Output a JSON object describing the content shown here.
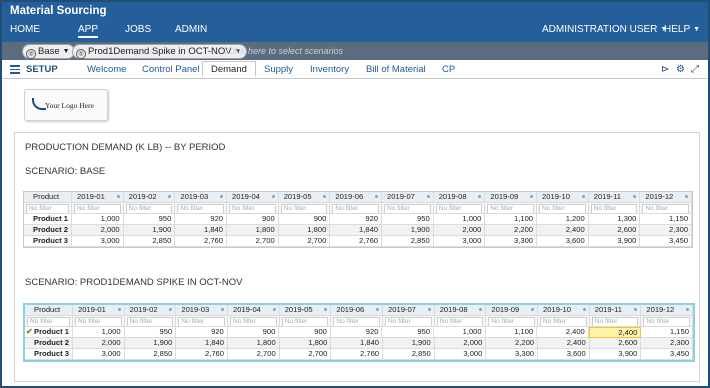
{
  "app": {
    "title": "Material Sourcing"
  },
  "nav": {
    "home": "HOME",
    "app": "APP",
    "jobs": "JOBS",
    "admin": "ADMIN",
    "user": "ADMINISTRATION USER",
    "help": "HELP"
  },
  "scenario_bar": {
    "base": "Base",
    "compare": "Prod1Demand Spike in OCT-NOV",
    "hint": "Click here to select scenarios"
  },
  "tabs": {
    "setup": "SETUP",
    "items": [
      "Welcome",
      "Control Panel",
      "Demand",
      "Supply",
      "Inventory",
      "Bill of Material",
      "CP"
    ],
    "active": "Demand"
  },
  "logo": {
    "text": "Your Logo Here"
  },
  "page": {
    "heading": "PRODUCTION DEMAND (K LB) -- BY PERIOD",
    "scenario1_title": "SCENARIO: BASE",
    "scenario2_title": "SCENARIO: PROD1DEMAND SPIKE IN OCT-NOV"
  },
  "grid": {
    "first_col": "Product",
    "filter_placeholder": "No filter",
    "periods": [
      "2019-01",
      "2019-02",
      "2019-03",
      "2019-04",
      "2019-05",
      "2019-06",
      "2019-07",
      "2019-08",
      "2019-09",
      "2019-10",
      "2019-11",
      "2019-12"
    ]
  },
  "base_rows": [
    {
      "product": "Product 1",
      "values": [
        "1,000",
        "950",
        "920",
        "900",
        "900",
        "920",
        "950",
        "1,000",
        "1,100",
        "1,200",
        "1,300",
        "1,150"
      ]
    },
    {
      "product": "Product 2",
      "values": [
        "2,000",
        "1,900",
        "1,840",
        "1,800",
        "1,800",
        "1,840",
        "1,900",
        "2,000",
        "2,200",
        "2,400",
        "2,600",
        "2,300"
      ]
    },
    {
      "product": "Product 3",
      "values": [
        "3,000",
        "2,850",
        "2,760",
        "2,700",
        "2,700",
        "2,760",
        "2,850",
        "3,000",
        "3,300",
        "3,600",
        "3,900",
        "3,450"
      ]
    }
  ],
  "spike_rows": [
    {
      "product": "Product 1",
      "values": [
        "1,000",
        "950",
        "920",
        "900",
        "900",
        "920",
        "950",
        "1,000",
        "1,100",
        "2,400",
        "2,400",
        "1,150"
      ]
    },
    {
      "product": "Product 2",
      "values": [
        "2,000",
        "1,900",
        "1,840",
        "1,800",
        "1,800",
        "1,840",
        "1,900",
        "2,000",
        "2,200",
        "2,400",
        "2,600",
        "2,300"
      ]
    },
    {
      "product": "Product 3",
      "values": [
        "3,000",
        "2,850",
        "2,760",
        "2,700",
        "2,700",
        "2,760",
        "2,850",
        "3,000",
        "3,300",
        "3,600",
        "3,900",
        "3,450"
      ]
    }
  ],
  "highlighted_cell": {
    "grid": "spike",
    "row": 0,
    "col": 10,
    "color": "#fff3a8"
  },
  "colors": {
    "nav": "#245f9b",
    "scenario_bar": "#5a6c7d",
    "link": "#1f5a96",
    "selection_border": "#8ecfe8"
  },
  "icons": [
    "menu-icon",
    "play-icon",
    "gear-icon",
    "expand-icon",
    "checkmark-icon"
  ]
}
